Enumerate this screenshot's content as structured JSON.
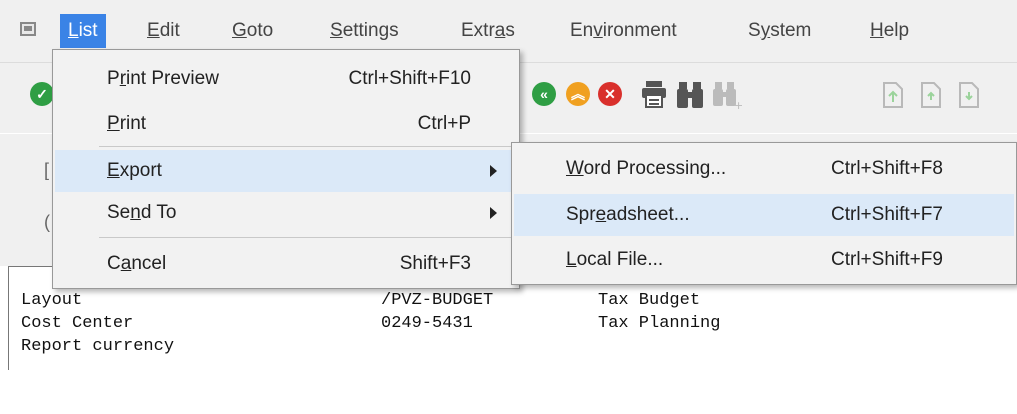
{
  "menubar": {
    "items": [
      {
        "label": "List",
        "mnemonic": "L",
        "active": true
      },
      {
        "label": "Edit",
        "mnemonic": "E"
      },
      {
        "label": "Goto",
        "mnemonic": "G"
      },
      {
        "label": "Settings",
        "mnemonic": "S"
      },
      {
        "label": "Extras",
        "mnemonic": "a"
      },
      {
        "label": "Environment",
        "mnemonic": "v"
      },
      {
        "label": "System",
        "mnemonic": "y"
      },
      {
        "label": "Help",
        "mnemonic": "H"
      }
    ]
  },
  "toolbar": {
    "icons": [
      "enter-check-icon",
      "back-icon",
      "exit-icon",
      "cancel-icon",
      "print-icon",
      "find-icon",
      "find-next-icon",
      "first-page-icon",
      "previous-page-icon",
      "next-page-icon"
    ]
  },
  "list_menu": {
    "items": [
      {
        "label": "Print Preview",
        "shortcut": "Ctrl+Shift+F10"
      },
      {
        "label": "Print",
        "shortcut": "Ctrl+P"
      },
      {
        "label": "Export",
        "shortcut": "",
        "submenu": true,
        "highlighted": true
      },
      {
        "label": "Send To",
        "shortcut": "",
        "submenu": true
      },
      {
        "label": "Cancel",
        "shortcut": "Shift+F3"
      }
    ]
  },
  "export_submenu": {
    "items": [
      {
        "label": "Word Processing...",
        "shortcut": "Ctrl+Shift+F8"
      },
      {
        "label": "Spreadsheet...",
        "shortcut": "Ctrl+Shift+F7",
        "highlighted": true
      },
      {
        "label": "Local File...",
        "shortcut": "Ctrl+Shift+F9"
      }
    ]
  },
  "report": {
    "rows": [
      {
        "label": "Layout",
        "value": "/PVZ-BUDGET",
        "description": "Tax Budget"
      },
      {
        "label": "Cost Center",
        "value": "0249-5431",
        "description": "Tax Planning"
      },
      {
        "label": "Report currency",
        "value": "",
        "description": ""
      }
    ]
  },
  "colors": {
    "menu_active": "#3a83e6",
    "menu_highlight": "#dbe9f8",
    "enter_green": "#2f9e44",
    "back_green": "#2f9e44",
    "exit_orange": "#f0a020",
    "cancel_red": "#d9302c"
  }
}
